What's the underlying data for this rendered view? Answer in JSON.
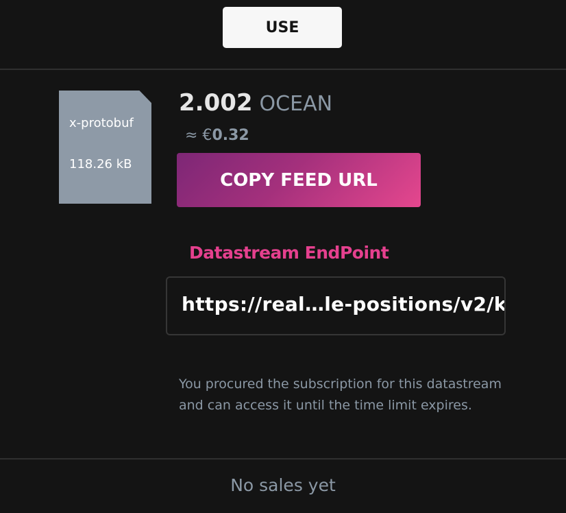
{
  "actions": {
    "use_label": "USE",
    "copy_label": "COPY FEED URL"
  },
  "file": {
    "type": "x-protobuf",
    "size": "118.26 kB"
  },
  "price": {
    "value": "2.002",
    "token": "OCEAN",
    "approx_symbol": "≈ €",
    "fiat_value": "0.32"
  },
  "endpoint": {
    "label": "Datastream EndPoint",
    "url": "https://real…le-positions/v2/k"
  },
  "notice": "You procured the subscription for this datastream and can access it until the time limit expires.",
  "sales_status": "No sales yet",
  "colors": {
    "background": "#141414",
    "accent_pink": "#e5408e",
    "gradient_start": "#7d2776",
    "gradient_end": "#e5478e",
    "muted_text": "#8b98a5",
    "file_icon": "#8e9aa7"
  },
  "icons": {
    "file": "document-icon"
  }
}
